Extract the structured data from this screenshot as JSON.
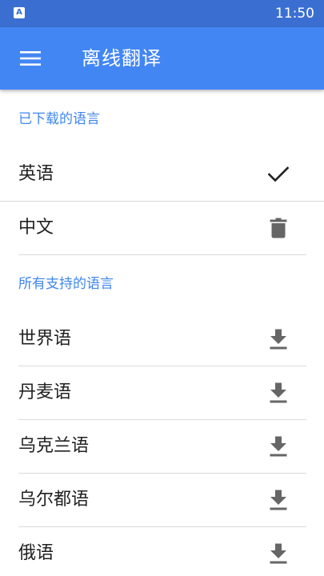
{
  "status_bar": {
    "app_icon_letter": "A",
    "time": "11:50"
  },
  "app_bar": {
    "title": "离线翻译",
    "menu_icon": "hamburger-menu-icon"
  },
  "colors": {
    "status_bar": "#3a6fd1",
    "app_bar": "#4286f4",
    "section_header": "#3f86ee",
    "icon": "#666666"
  },
  "downloaded_section": {
    "header": "已下载的语言",
    "items": [
      {
        "label": "英语",
        "action_icon": "checkmark-icon"
      },
      {
        "label": "中文",
        "action_icon": "trash-icon"
      }
    ]
  },
  "all_section": {
    "header": "所有支持的语言",
    "items": [
      {
        "label": "世界语",
        "action_icon": "download-icon"
      },
      {
        "label": "丹麦语",
        "action_icon": "download-icon"
      },
      {
        "label": "乌克兰语",
        "action_icon": "download-icon"
      },
      {
        "label": "乌尔都语",
        "action_icon": "download-icon"
      },
      {
        "label": "俄语",
        "action_icon": "download-icon"
      }
    ]
  }
}
